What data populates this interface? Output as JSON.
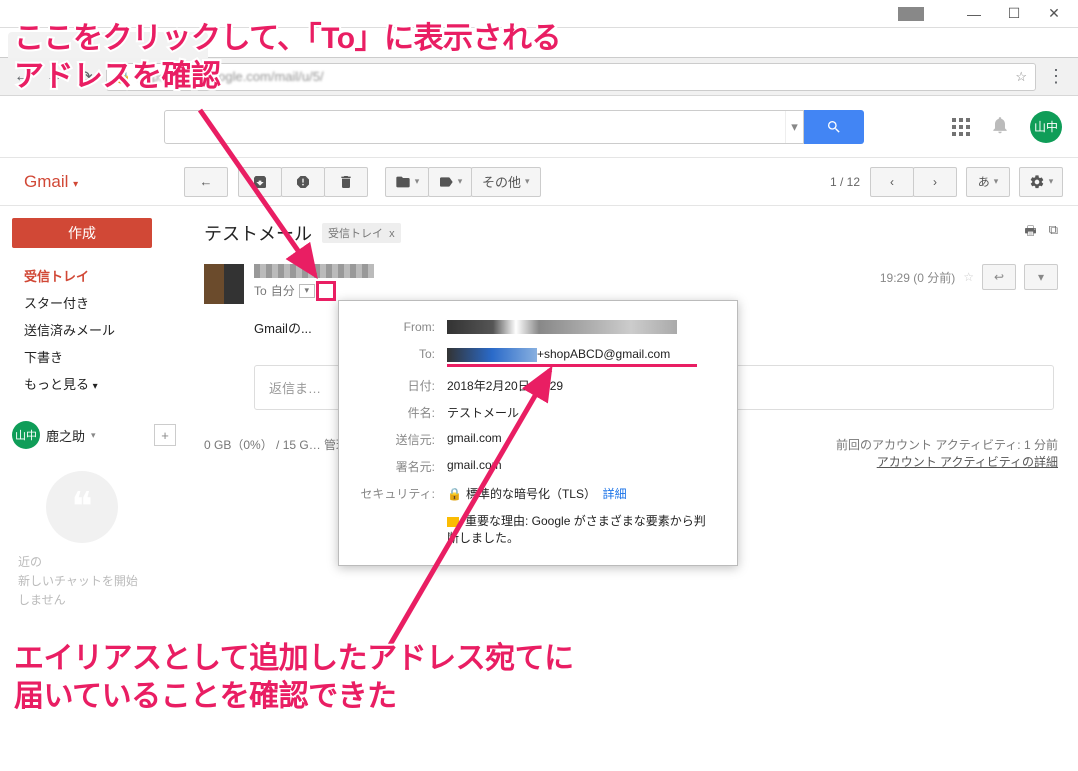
{
  "window": {
    "min": "—",
    "max": "☐",
    "close": "✕"
  },
  "chrome": {
    "url": "https://mail.google.com/mail/u/5/"
  },
  "gheader": {
    "avatar": "山中"
  },
  "toolbar": {
    "gmail": "Gmail",
    "more": "その他",
    "count": "1 / 12",
    "lang": "あ"
  },
  "sidebar": {
    "compose": "作成",
    "items": [
      "受信トレイ",
      "スター付き",
      "送信済みメール",
      "下書き",
      "もっと見る"
    ],
    "contact": "鹿之助",
    "faded1": "近の",
    "faded2": "新しいチャットを開始",
    "faded3": "しません"
  },
  "mail": {
    "subject": "テストメール",
    "label": "受信トレイ",
    "to_prefix": "To",
    "to_self": "自分",
    "time": "19:29 (0 分前)",
    "body": "Gmailの...",
    "reply_placeholder": "返信ま…",
    "storage": "0 GB（0%） / 15 G… 管理",
    "activity1": "前回のアカウント アクティビティ: 1 分前",
    "activity2": "アカウント アクティビティの詳細"
  },
  "popover": {
    "from_k": "From:",
    "to_k": "To:",
    "to_suffix": "+shopABCD@gmail.com",
    "date_k": "日付:",
    "date_v": "2018年2月20日 19:29",
    "subj_k": "件名:",
    "subj_v": "テストメール",
    "sender_k": "送信元:",
    "sender_v": "gmail.com",
    "signed_k": "署名元:",
    "signed_v": "gmail.com",
    "sec_k": "セキュリティ:",
    "sec_v": "標準的な暗号化（TLS）",
    "sec_link": "詳細",
    "reason": "重要な理由: Google がさまざまな要素から判断しました。"
  },
  "anno": {
    "top": "ここをクリックして、「To」に表示される\nアドレスを確認",
    "bottom": "エイリアスとして追加したアドレス宛てに\n届いていることを確認できた"
  }
}
